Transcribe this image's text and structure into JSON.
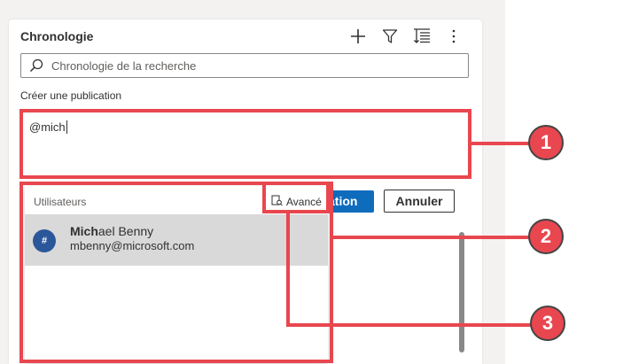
{
  "panel": {
    "title": "Chronologie",
    "toolbar_icons": [
      "plus-icon",
      "filter-icon",
      "sort-icon",
      "more-icon"
    ]
  },
  "search": {
    "placeholder": "Chronologie de la recherche"
  },
  "compose": {
    "label": "Créer une publication",
    "text": "@mich",
    "post_button_visible_text": "ation",
    "cancel_label": "Annuler"
  },
  "mention_dropdown": {
    "header": "Utilisateurs",
    "advanced_label": "Avancé",
    "items": [
      {
        "avatar": "#",
        "name_match": "Mich",
        "name_rest": "ael Benny",
        "email": "mbenny@microsoft.com"
      }
    ]
  },
  "callouts": [
    "1",
    "2",
    "3"
  ],
  "colors": {
    "callout": "#e8474f",
    "primary": "#0f6cbd",
    "avatar": "#2b579a"
  }
}
